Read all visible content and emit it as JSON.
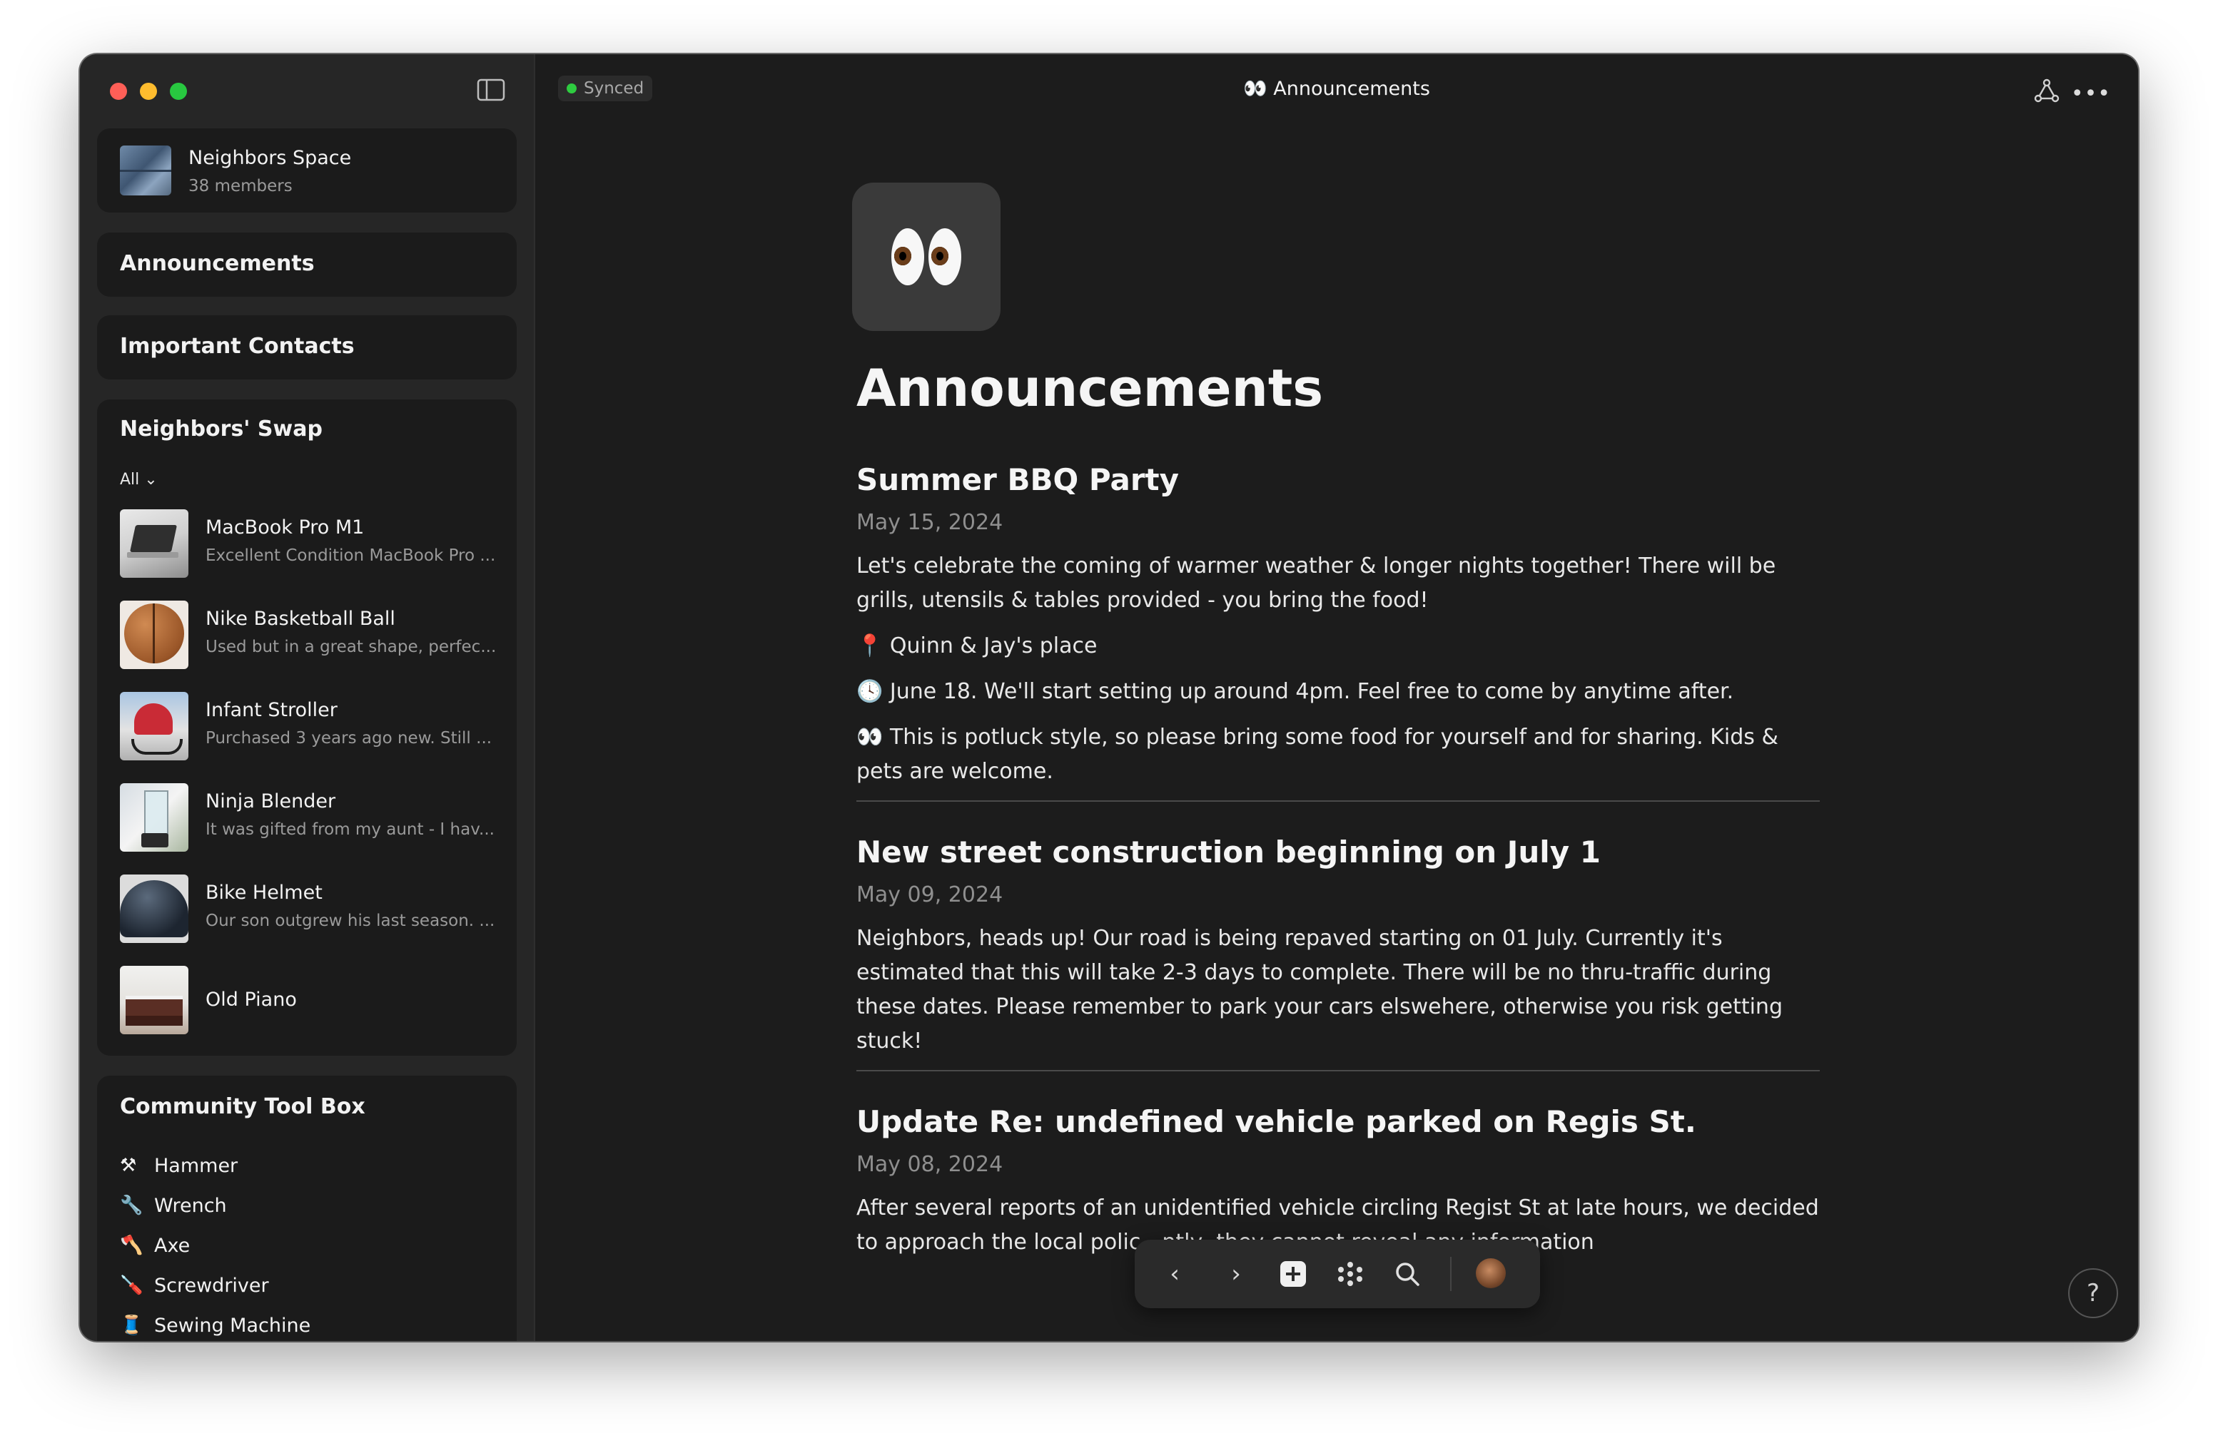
{
  "sidebar": {
    "space": {
      "name": "Neighbors Space",
      "members": "38 members"
    },
    "nav": [
      {
        "label": "Announcements"
      },
      {
        "label": "Important Contacts"
      }
    ],
    "swap": {
      "title": "Neighbors' Swap",
      "filter": "All ⌄",
      "items": [
        {
          "name": "MacBook Pro M1",
          "desc": "Excellent Condition MacBook Pro ..."
        },
        {
          "name": "Nike Basketball Ball",
          "desc": "Used but in a great shape, perfec..."
        },
        {
          "name": "Infant Stroller",
          "desc": "Purchased 3 years ago new. Still ..."
        },
        {
          "name": "Ninja Blender",
          "desc": "It was gifted from my aunt - I hav..."
        },
        {
          "name": "Bike Helmet",
          "desc": "Our son outgrew his last season. ..."
        },
        {
          "name": "Old Piano",
          "desc": ""
        }
      ]
    },
    "toolbox": {
      "title": "Community Tool Box",
      "items": [
        {
          "icon": "⚒",
          "label": "Hammer"
        },
        {
          "icon": "🔧",
          "label": "Wrench"
        },
        {
          "icon": "🪓",
          "label": "Axe"
        },
        {
          "icon": "🪛",
          "label": "Screwdriver"
        },
        {
          "icon": "🧵",
          "label": "Sewing Machine"
        }
      ]
    }
  },
  "topbar": {
    "status": "Synced",
    "title": "👀 Announcements",
    "status_color": "#2ecc40"
  },
  "doc": {
    "emoji": "eyes-emoji",
    "title": "Announcements",
    "posts": [
      {
        "title": "Summer BBQ Party",
        "date": "May 15, 2024",
        "paragraphs": [
          "Let's celebrate the coming of warmer weather & longer nights together! There will be grills, utensils & tables provided - you bring the food!",
          "📍 Quinn & Jay's place",
          "🕓  June 18. We'll start setting up around 4pm. Feel free to come by anytime after.",
          "👀 This is potluck style, so please bring some food for yourself and for sharing. Kids & pets are welcome."
        ]
      },
      {
        "title": "New street construction beginning on July 1",
        "date": "May 09, 2024",
        "paragraphs": [
          "Neighbors, heads up! Our road is being repaved starting on 01 July. Currently it's estimated that this will take 2-3 days to complete. There will be no thru-traffic during these dates. Please remember to park your cars elswehere, otherwise you risk getting stuck!"
        ]
      },
      {
        "title": "Update Re: undefined vehicle parked on Regis St.",
        "date": "May 08, 2024",
        "paragraphs": [
          "After several reports of an unidentified vehicle circling Regist St at late hours, we decided to approach the local polic…ntly, they cannot reveal any information"
        ]
      }
    ]
  },
  "toolbar": {
    "back": "‹",
    "forward": "›",
    "new": "+",
    "apps": "⁙",
    "search": "search-icon"
  },
  "help": "?"
}
